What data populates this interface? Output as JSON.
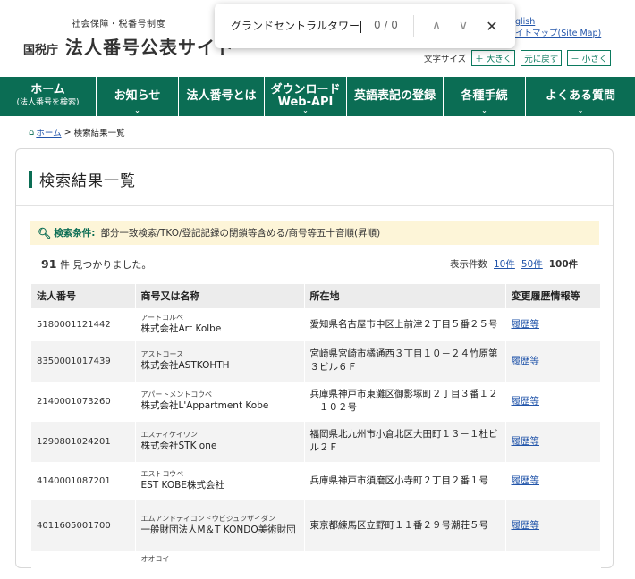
{
  "header": {
    "logo_top": "社会保障・税番号制度",
    "agency": "国税庁",
    "title": "法人番号公表サイト",
    "links": [
      "glish",
      "イトマップ(Site Map)"
    ],
    "font_size_label": "文字サイズ",
    "font_size_buttons": [
      "＋ 大きく",
      "元に戻す",
      "－ 小さく"
    ]
  },
  "findbar": {
    "query": "グランドセントラルタワー",
    "count": "0 / 0",
    "up_icon": "∧",
    "down_icon": "∨",
    "close_icon": "✕"
  },
  "nav": {
    "items": [
      {
        "label": "ホーム",
        "sub": "(法人番号を検索)"
      },
      {
        "label": "お知らせ"
      },
      {
        "label": "法人番号とは"
      },
      {
        "label": "ダウンロード\nWeb-API"
      },
      {
        "label": "英語表記の登録"
      },
      {
        "label": "各種手続"
      },
      {
        "label": "よくある質問"
      }
    ]
  },
  "breadcrumb": {
    "home": "ホーム",
    "current": "検索結果一覧"
  },
  "page": {
    "title": "検索結果一覧",
    "conditions_label": "検索条件:",
    "conditions_value": "部分一致検索/TKO/登記記録の閉鎖等含める/商号等五十音順(昇順)",
    "found_count": "91",
    "found_text": "件 見つかりました。",
    "per_page_label": "表示件数",
    "per_page_options": [
      "10件",
      "50件",
      "100件"
    ]
  },
  "table": {
    "headers": [
      "法人番号",
      "商号又は名称",
      "所在地",
      "変更履歴情報等"
    ],
    "rows": [
      {
        "no": "5180001121442",
        "kana": "アートコルベ",
        "name": "株式会社Art Kolbe",
        "addr": "愛知県名古屋市中区上前津２丁目５番２５号",
        "hist": "履歴等"
      },
      {
        "no": "8350001017439",
        "kana": "アストコース",
        "name": "株式会社ASTKOHTH",
        "addr": "宮崎県宮崎市橘通西３丁目１０－２４竹原第３ビル６Ｆ",
        "hist": "履歴等"
      },
      {
        "no": "2140001073260",
        "kana": "アパートメントコウベ",
        "name": "株式会社L'Appartment Kobe",
        "addr": "兵庫県神戸市東灘区御影塚町２丁目３番１２－１０２号",
        "hist": "履歴等"
      },
      {
        "no": "1290801024201",
        "kana": "エスティケイワン",
        "name": "株式会社STK one",
        "addr": "福岡県北九州市小倉北区大田町１３－１杜ビル２Ｆ",
        "hist": "履歴等"
      },
      {
        "no": "4140001087201",
        "kana": "エストコウベ",
        "name": "EST KOBE株式会社",
        "addr": "兵庫県神戸市須磨区小寺町２丁目２番１号",
        "hist": "履歴等"
      },
      {
        "no": "4011605001700",
        "kana": "エムアンドティコンドウビジュツザイダン",
        "name": "一般財団法人M＆T KONDO美術財団",
        "addr": "東京都練馬区立野町１１番２９号潮荘５号",
        "hist": "履歴等"
      },
      {
        "no": "",
        "kana": "オオコイ",
        "name": "",
        "addr": "",
        "hist": ""
      }
    ]
  }
}
